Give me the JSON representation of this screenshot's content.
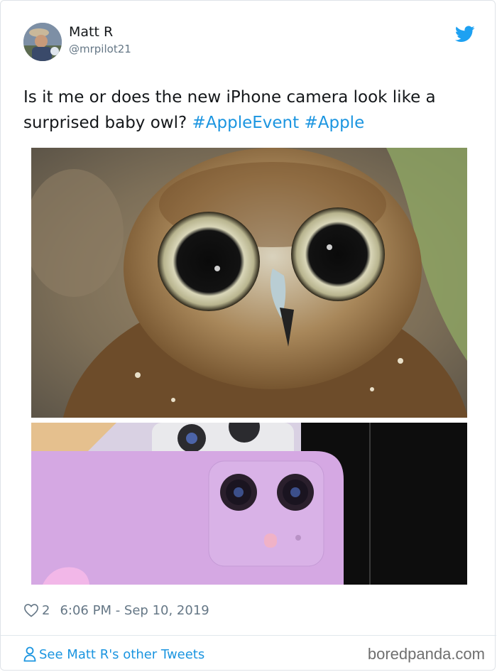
{
  "tweet": {
    "author_name": "Matt R",
    "author_handle": "@mrpilot21",
    "text_plain": "Is it me or does the new iPhone camera look like a surprised baby owl?",
    "hashtags": [
      "#AppleEvent",
      "#Apple"
    ],
    "like_count": "2",
    "timestamp": "6:06 PM - Sep 10, 2019",
    "see_more_label": "See Matt R's other Tweets"
  },
  "icons": {
    "like": "heart-icon",
    "brand": "twitter-bird-icon",
    "profile": "person-icon"
  },
  "colors": {
    "link": "#1b95e0",
    "secondary_text": "#657786",
    "twitter_blue": "#1da1f2"
  },
  "watermark": "boredpanda.com"
}
